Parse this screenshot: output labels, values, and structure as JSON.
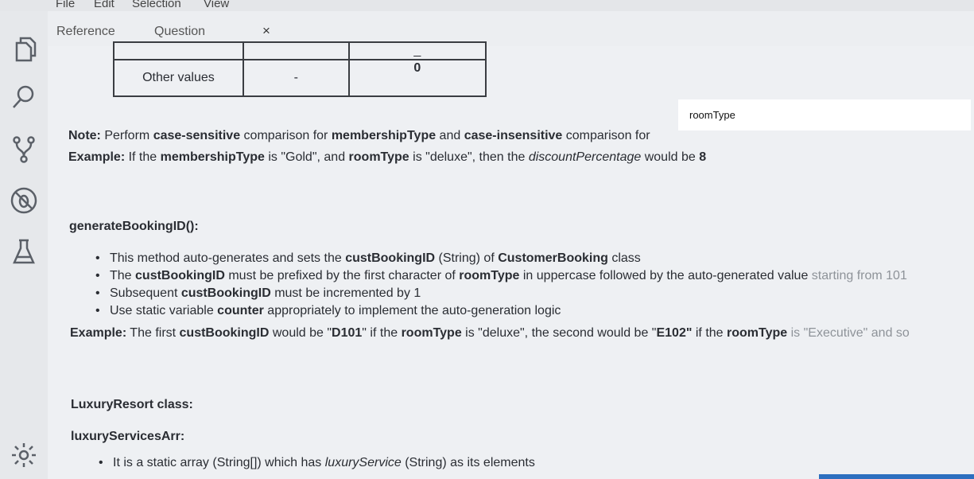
{
  "menu": [
    "File",
    "Edit",
    "Selection",
    "View"
  ],
  "tabs": [
    {
      "label": "Reference"
    },
    {
      "label": "Question"
    }
  ],
  "tab_close_glyph": "×",
  "icons": [
    "files-icon",
    "search-icon",
    "source-control-icon",
    "debug-icon",
    "beaker-icon",
    "settings-icon"
  ],
  "table": {
    "rows": [
      [
        "",
        "",
        "_"
      ],
      [
        "Other values",
        "-",
        "0"
      ]
    ]
  },
  "note": {
    "label": "Note:",
    "t1": " Perform ",
    "b1": "case-sensitive",
    "t2": " comparison for ",
    "b2": "membershipType",
    "t3": " and ",
    "b3": "case-insensitive",
    "t4": " comparison for"
  },
  "overlay_text": "roomType",
  "example1": {
    "label": "Example:",
    "t1": " If the ",
    "b1": "membershipType",
    "t2": " is \"Gold\", and ",
    "b2": "roomType",
    "t3": " is \"deluxe\", then the ",
    "i1": "discountPercentage",
    "t4": " would be ",
    "b3": "8"
  },
  "method_heading": "generateBookingID():",
  "bullets1": [
    {
      "t1": "This method auto-generates and sets the ",
      "b1": "custBookingID",
      "t2": " (String) of ",
      "b2": "CustomerBooking",
      "t3": " class"
    },
    {
      "t1": "The ",
      "b1": "custBookingID",
      "t2": " must be prefixed by the first character of ",
      "b2": "roomType",
      "t3": " in uppercase followed by the auto-generated value ",
      "f1": "starting from 101"
    },
    {
      "t1": "Subsequent ",
      "b1": "custBookingID",
      "t2": " must be incremented by 1"
    },
    {
      "t1": "Use static variable ",
      "b1": "counter",
      "t2": " appropriately to implement the auto-generation logic"
    }
  ],
  "example2": {
    "label": "Example:",
    "t1": " The first ",
    "b1": "custBookingID",
    "t2": " would be \"",
    "b2": "D101",
    "t3": "\" if the ",
    "b3": "roomType",
    "t4": " is \"deluxe\", the second would be \"",
    "b4": "E102\"",
    "t5": " if the ",
    "b5": "roomType",
    "f1": " is \"Executive\" and so"
  },
  "class_heading": "LuxuryResort class:",
  "array_heading": "luxuryServicesArr:",
  "bullets2": [
    {
      "t1": "It is a static array (String[]) which has ",
      "i1": "luxuryService",
      "t2": " (String) as its elements"
    }
  ],
  "colors": {
    "accent": "#2d6fbf",
    "background": "#eef0f3"
  }
}
